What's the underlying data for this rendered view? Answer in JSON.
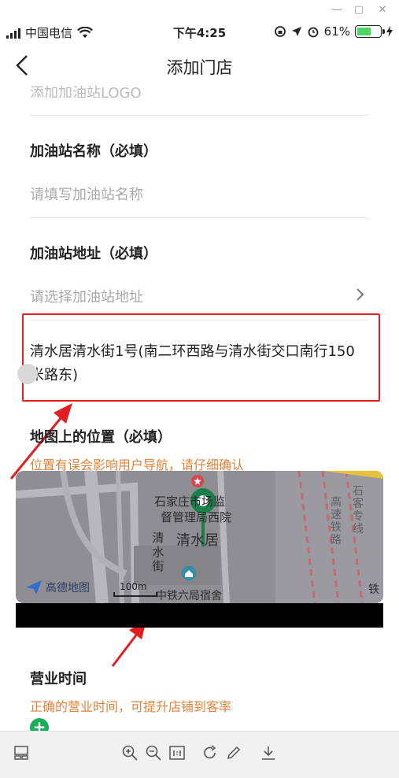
{
  "status_bar": {
    "carrier": "中国电信",
    "time": "下午4:25",
    "battery": "61%",
    "battery_level": 0.61
  },
  "nav": {
    "title": "添加门店"
  },
  "form": {
    "logo_label_cut": "添加加油站LOGO",
    "name_label": "加油站名称（必填）",
    "name_placeholder": "请填写加油站名称",
    "address_label": "加油站地址（必填）",
    "address_placeholder": "请选择加油站地址",
    "address_value": "清水居清水街1号(南二环西路与清水街交口南行150米路东)",
    "map_label": "地图上的位置（必填）",
    "map_hint": "位置有误会影响用户导航，请仔细确认",
    "hours_label": "营业时间",
    "hours_hint": "正确的营业时间，可提升店铺到客率"
  },
  "map": {
    "poi_1": "石家庄市场监",
    "poi_1b": "督管理局西院",
    "poi_2": "清水居",
    "street_v": "清水街",
    "poi_3": "中铁六局宿舍",
    "rail_text": "高速铁路",
    "area_text": "石客专线",
    "edge_text": "铁",
    "logo": "高德地图",
    "scale": "100m"
  },
  "colors": {
    "accent_hint": "#e0823a",
    "annotation_red": "#e02020",
    "pin_green": "#1a7f4b"
  }
}
